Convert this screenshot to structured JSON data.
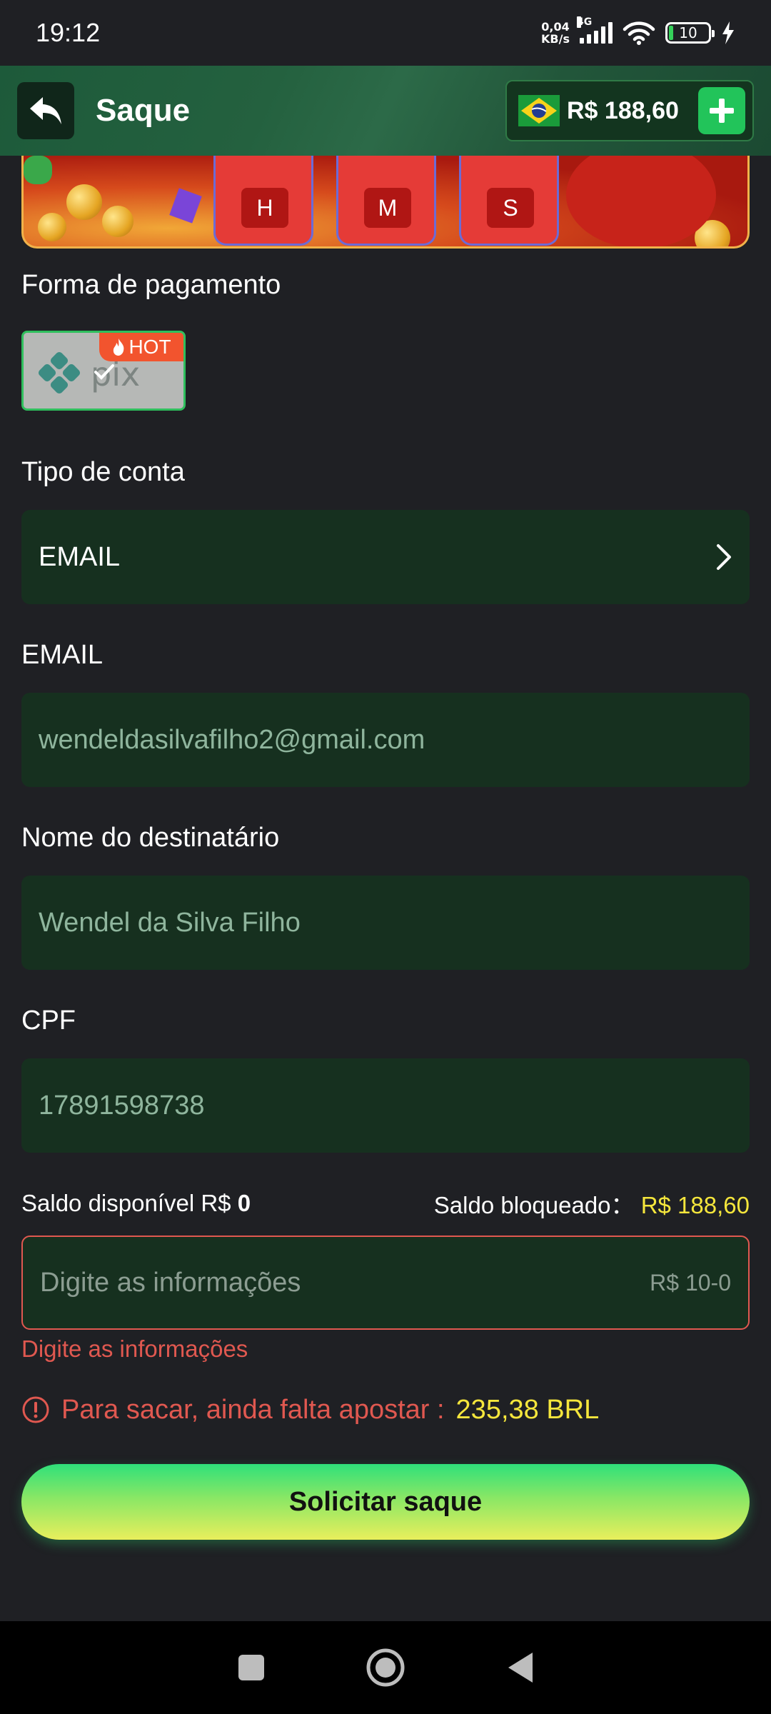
{
  "status_bar": {
    "time": "19:12",
    "net_speed_value": "0,04",
    "net_speed_unit": "KB/s",
    "network_type": "4G",
    "battery": "10"
  },
  "header": {
    "title": "Saque",
    "balance": "R$ 188,60"
  },
  "banner": {
    "timer_units": [
      "H",
      "M",
      "S"
    ]
  },
  "payment": {
    "label": "Forma de pagamento",
    "hot_badge": "HOT"
  },
  "account_type": {
    "label": "Tipo de conta",
    "value": "EMAIL"
  },
  "email": {
    "label": "EMAIL",
    "value": "wendeldasilvafilho2@gmail.com"
  },
  "recipient": {
    "label": "Nome do destinatário",
    "value": "Wendel da Silva Filho"
  },
  "cpf": {
    "label": "CPF",
    "value": "17891598738"
  },
  "balances": {
    "available_label": "Saldo disponível R$",
    "available_value": "0",
    "blocked_label": "Saldo bloqueado：",
    "blocked_value": "R$ 188,60"
  },
  "amount": {
    "placeholder": "Digite as informações",
    "range": "R$ 10-0",
    "error": "Digite as informações"
  },
  "warning": {
    "text": "Para sacar, ainda falta apostar :",
    "value": "235,38 BRL"
  },
  "submit": {
    "label": "Solicitar saque"
  },
  "colors": {
    "background": "#1f2024",
    "field": "#16301f",
    "accent_green": "#22c45a",
    "error_red": "#e05850",
    "highlight_yellow": "#f5e63c"
  }
}
